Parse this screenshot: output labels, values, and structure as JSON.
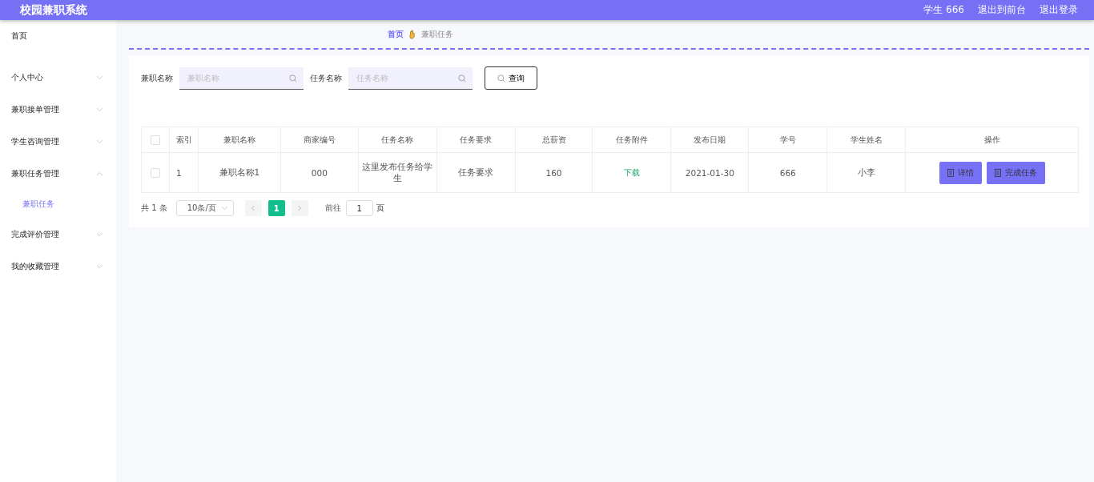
{
  "header": {
    "title": "校园兼职系统",
    "links": [
      "学生 666",
      "退出到前台",
      "退出登录"
    ]
  },
  "sidebar": {
    "items": [
      {
        "label": "首页"
      },
      {
        "label": "个人中心",
        "expanded": false
      },
      {
        "label": "兼职接单管理",
        "expanded": false
      },
      {
        "label": "学生咨询管理",
        "expanded": false
      },
      {
        "label": "兼职任务管理",
        "expanded": true,
        "children": [
          {
            "label": "兼职任务",
            "selected": true
          }
        ]
      },
      {
        "label": "完成评价管理",
        "expanded": false
      },
      {
        "label": "我的收藏管理",
        "expanded": false
      }
    ]
  },
  "breadcrumb": [
    "首页",
    "兼职任务"
  ],
  "search": {
    "fields": [
      {
        "label": "兼职名称",
        "placeholder": "兼职名称"
      },
      {
        "label": "任务名称",
        "placeholder": "任务名称"
      }
    ],
    "button": "查询"
  },
  "table": {
    "columns": [
      "索引",
      "兼职名称",
      "商家编号",
      "任务名称",
      "任务要求",
      "总薪资",
      "任务附件",
      "发布日期",
      "学号",
      "学生姓名",
      "操作"
    ],
    "header_checked": false,
    "rows": [
      {
        "checked": false,
        "cells": [
          "1",
          "兼职名称1",
          "000",
          "这里发布任务给学生",
          "任务要求",
          "160"
        ],
        "attachment": "下载",
        "cells2": [
          "2021-01-30",
          "666",
          "小李"
        ],
        "actions": [
          "详情",
          "完成任务"
        ]
      }
    ]
  },
  "pagination": {
    "total": "共 1 条",
    "page_size": "10条/页",
    "pages": [
      {
        "label": "1",
        "selected": true
      }
    ],
    "goto_label": "前往",
    "goto_value": "1",
    "page_suffix": "页"
  }
}
